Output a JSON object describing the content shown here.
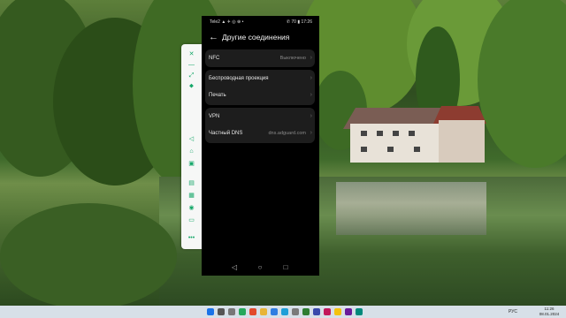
{
  "status_bar": {
    "left": "Tele2 ▲ ✈ ◎ ⊕ •",
    "right": "✆ 70 ▮ 17:26"
  },
  "header": {
    "title": "Другие соединения"
  },
  "settings": {
    "nfc": {
      "label": "NFC",
      "value": "Выключено"
    },
    "projection": {
      "label": "Беспроводная проекция"
    },
    "print": {
      "label": "Печать"
    },
    "vpn": {
      "label": "VPN"
    },
    "private_dns": {
      "label": "Частный DNS",
      "value": "dns.adguard.com"
    }
  },
  "side_toolbar": {
    "icons": [
      "close-icon",
      "minimize-icon",
      "expand-icon",
      "pin-icon",
      "volume-icon",
      "home-icon",
      "screenshot-icon",
      "menu-icon",
      "keyboard-icon",
      "camera-icon",
      "folder-icon",
      "more-icon"
    ],
    "glyphs": [
      "✕",
      "—",
      "⤢",
      "⬥",
      "◁",
      "⌂",
      "▣",
      "▤",
      "▦",
      "◉",
      "▭",
      "•••"
    ]
  },
  "nav_bar": {
    "back": "◁",
    "home": "○",
    "recent": "□"
  },
  "taskbar": {
    "language": "РУС",
    "time": "11:26",
    "date": "08.01.2024"
  }
}
